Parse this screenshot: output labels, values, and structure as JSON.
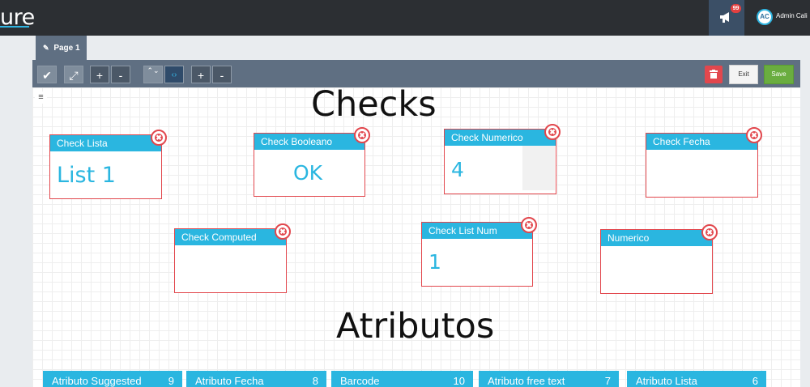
{
  "header": {
    "logo_text": "ure",
    "notification_count": "99",
    "user_initials": "AC",
    "user_name": "Admin Cali"
  },
  "tabs": [
    {
      "label": "Page 1"
    }
  ],
  "toolbar": {
    "buttons": [
      "✔",
      "⤢",
      "+",
      "-",
      "⌃⌄",
      "‹›",
      "+",
      "-"
    ],
    "exit_label": "Exit",
    "save_label": "Save"
  },
  "sections": {
    "checks_title": "Checks",
    "atributos_title": "Atributos"
  },
  "widgets": [
    {
      "title": "Check Lista",
      "value": "List 1"
    },
    {
      "title": "Check Booleano",
      "value": "OK"
    },
    {
      "title": "Check Numerico",
      "value": "4"
    },
    {
      "title": "Check Fecha",
      "value": ""
    },
    {
      "title": "Check Computed",
      "value": ""
    },
    {
      "title": "Check List Num",
      "value": "1"
    },
    {
      "title": "Numerico",
      "value": ""
    }
  ],
  "attributes": [
    {
      "label": "Atributo Suggested",
      "count": "9"
    },
    {
      "label": "Atributo Fecha",
      "count": "8"
    },
    {
      "label": "Barcode",
      "count": "10"
    },
    {
      "label": "Atributo free text",
      "count": "7"
    },
    {
      "label": "Atributo Lista",
      "count": "6"
    }
  ],
  "colors": {
    "accent": "#2ab6e0",
    "danger": "#e2474d",
    "save": "#6aad3f",
    "topbar": "#2c2f33",
    "toolbar": "#5f6f82"
  }
}
